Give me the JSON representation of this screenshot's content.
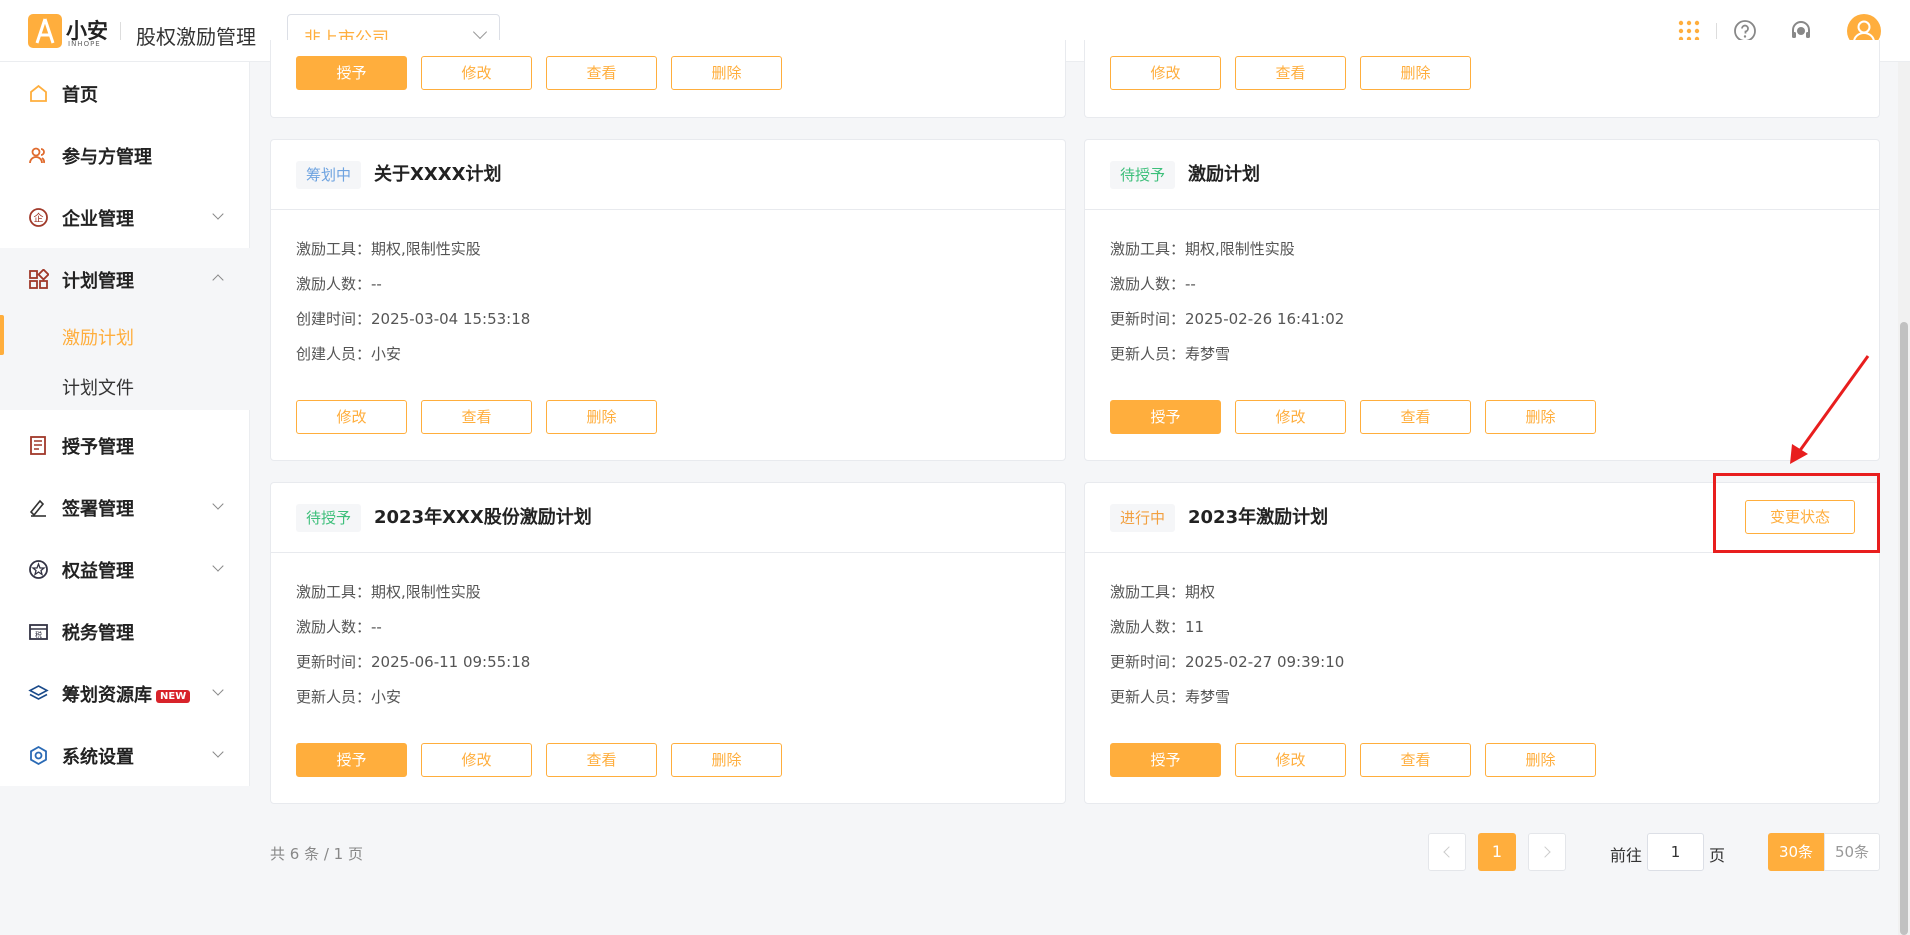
{
  "header": {
    "logo_text": "小安",
    "logo_sub": "INHOPE",
    "app_title": "股权激励管理",
    "company_select": "非上市公司",
    "icons": [
      "apps-grid-icon",
      "help-icon",
      "headset-icon",
      "user-avatar-icon"
    ]
  },
  "sidebar": {
    "items": [
      {
        "label": "首页",
        "icon": "home-icon"
      },
      {
        "label": "参与方管理",
        "icon": "users-icon"
      },
      {
        "label": "企业管理",
        "icon": "enterprise-icon"
      },
      {
        "label": "计划管理",
        "icon": "plan-grid-icon"
      },
      {
        "label": "授予管理",
        "icon": "ledger-icon"
      },
      {
        "label": "签署管理",
        "icon": "sign-icon"
      },
      {
        "label": "权益管理",
        "icon": "equity-icon"
      },
      {
        "label": "税务管理",
        "icon": "tax-icon"
      },
      {
        "label": "筹划资源库",
        "icon": "layers-icon",
        "badge": "NEW"
      },
      {
        "label": "系统设置",
        "icon": "settings-icon"
      }
    ],
    "sub_items": [
      {
        "label": "激励计划",
        "active": true
      },
      {
        "label": "计划文件",
        "active": false
      }
    ]
  },
  "buttons": {
    "grant": "授予",
    "edit": "修改",
    "view": "查看",
    "delete": "删除",
    "change_status": "变更状态"
  },
  "cards": [
    {
      "status": "筹划中",
      "title": "关于XXXX计划",
      "info": [
        {
          "label": "激励工具：",
          "value": "期权,限制性实股"
        },
        {
          "label": "激励人数：",
          "value": "--"
        },
        {
          "label": "创建时间：",
          "value": "2025-03-04 15:53:18"
        },
        {
          "label": "创建人员：",
          "value": "小安"
        }
      ]
    },
    {
      "status": "待授予",
      "title": "激励计划",
      "info": [
        {
          "label": "激励工具：",
          "value": "期权,限制性实股"
        },
        {
          "label": "激励人数：",
          "value": "--"
        },
        {
          "label": "更新时间：",
          "value": "2025-02-26 16:41:02"
        },
        {
          "label": "更新人员：",
          "value": "寿梦雪"
        }
      ]
    },
    {
      "status": "待授予",
      "title": "2023年XXX股份激励计划",
      "info": [
        {
          "label": "激励工具：",
          "value": "期权,限制性实股"
        },
        {
          "label": "激励人数：",
          "value": "--"
        },
        {
          "label": "更新时间：",
          "value": "2025-06-11 09:55:18"
        },
        {
          "label": "更新人员：",
          "value": "小安"
        }
      ]
    },
    {
      "status": "进行中",
      "title": "2023年激励计划",
      "info": [
        {
          "label": "激励工具：",
          "value": "期权"
        },
        {
          "label": "激励人数：",
          "value": "11"
        },
        {
          "label": "更新时间：",
          "value": "2025-02-27 09:39:10"
        },
        {
          "label": "更新人员：",
          "value": "寿梦雪"
        }
      ]
    }
  ],
  "pagination": {
    "total_text": "共 6 条 / 1 页",
    "current_page": "1",
    "goto_label": "前往",
    "goto_value": "1",
    "goto_suffix": "页",
    "size_30": "30条",
    "size_50": "50条"
  },
  "colors": {
    "accent": "#ffae3d",
    "highlight": "#e81e1e"
  }
}
